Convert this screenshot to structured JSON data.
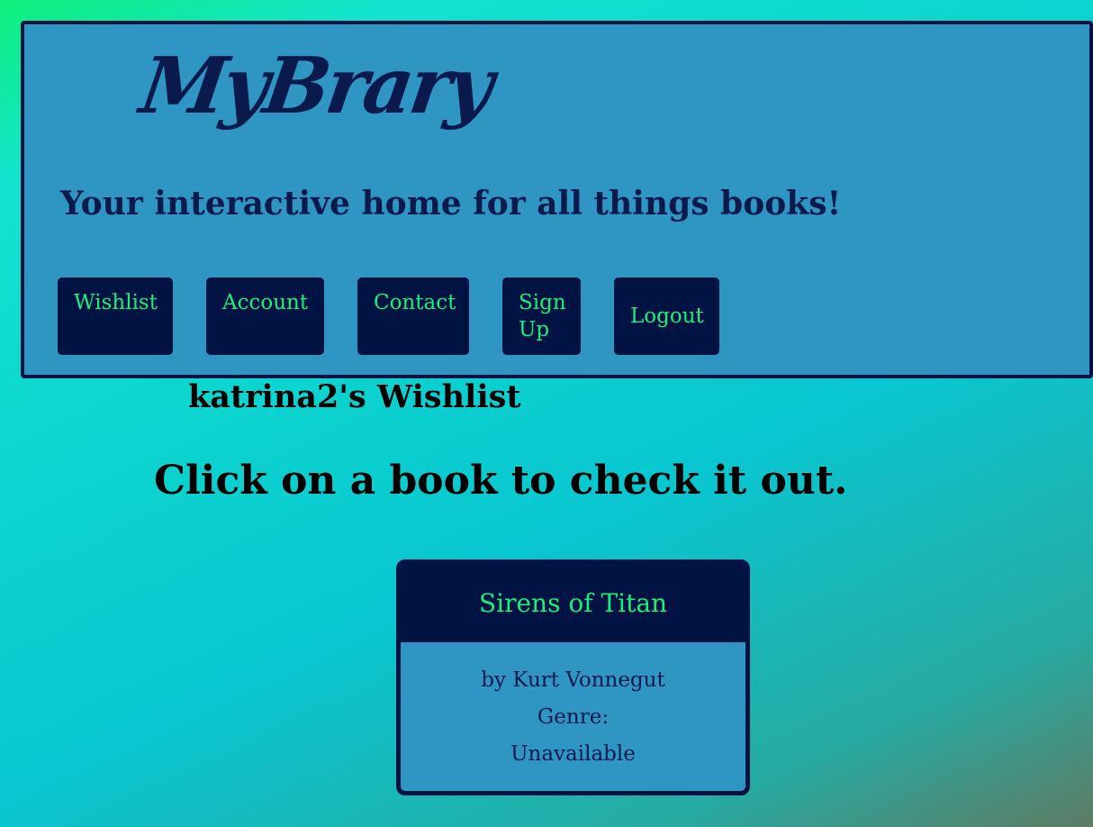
{
  "header": {
    "logo_text": "MyBrary",
    "tagline": "Your interactive home for all things books!",
    "nav": {
      "wishlist": "Wishlist",
      "account": "Account",
      "contact": "Contact",
      "signup_line1": "Sign",
      "signup_line2": "Up",
      "logout": "Logout"
    }
  },
  "main": {
    "wishlist_title": "katrina2's Wishlist",
    "instruction": "Click on a book to check it out.",
    "books": [
      {
        "title": "Sirens of Titan",
        "author_line": "by Kurt Vonnegut",
        "genre_label": "Genre:",
        "genre_value": "Unavailable"
      }
    ]
  },
  "colors": {
    "accent_green": "#19f07c",
    "navy": "#001342",
    "panel_blue": "#2f96c4"
  }
}
